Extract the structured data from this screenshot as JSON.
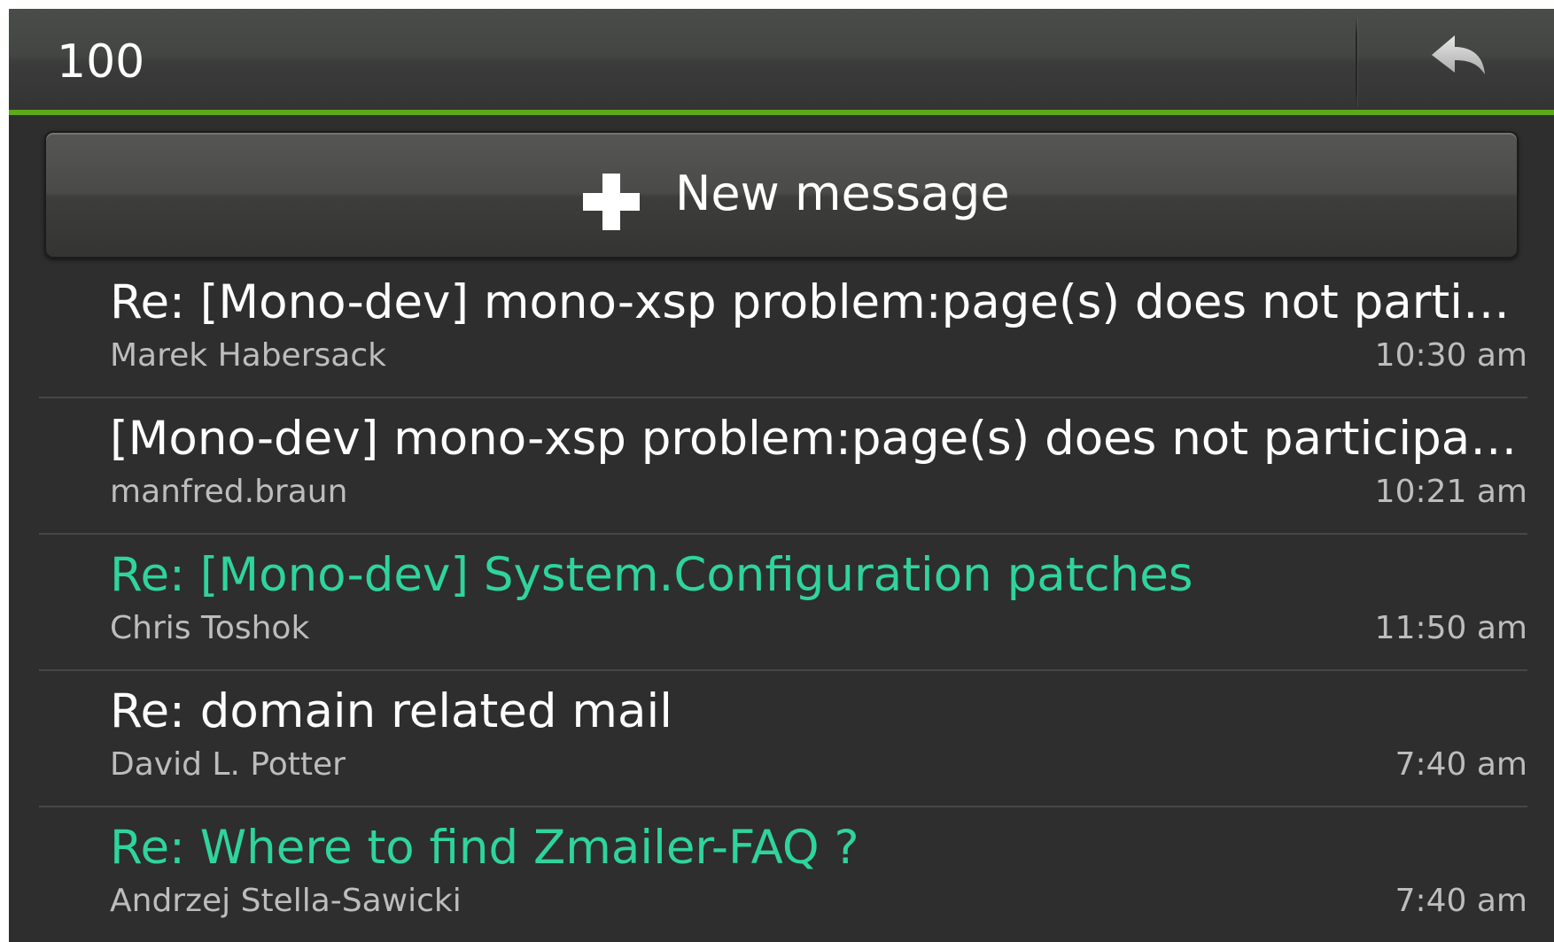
{
  "header": {
    "title": "100",
    "back_icon": "reply-arrow-icon"
  },
  "new_message": {
    "label": "New message",
    "icon": "plus-icon"
  },
  "colors": {
    "accent": "#5ea81b",
    "unread_subject": "#2fd49c",
    "read_subject": "#ffffff",
    "meta": "#bdbdbd"
  },
  "messages": [
    {
      "subject": "Re: [Mono-dev] mono-xsp problem:page(s) does not partic…",
      "sender": "Marek Habersack",
      "time": "10:30 am",
      "unread": false
    },
    {
      "subject": "[Mono-dev] mono-xsp problem:page(s) does not participat…",
      "sender": "manfred.braun",
      "time": "10:21 am",
      "unread": false
    },
    {
      "subject": "Re: [Mono-dev] System.Configuration patches",
      "sender": "Chris Toshok",
      "time": "11:50 am",
      "unread": true
    },
    {
      "subject": "Re: domain related mail",
      "sender": "David L. Potter",
      "time": "7:40 am",
      "unread": false
    },
    {
      "subject": "Re: Where to find Zmailer-FAQ ?",
      "sender": "Andrzej Stella-Sawicki",
      "time": "7:40 am",
      "unread": true
    }
  ]
}
